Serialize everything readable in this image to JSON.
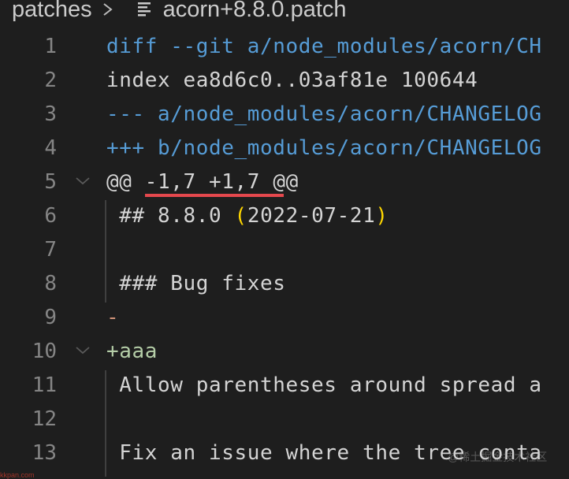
{
  "breadcrumb": {
    "folder": "patches",
    "separator_icon": "chevron-right-icon",
    "file_icon": "text-file-lines-icon",
    "file": "acorn+8.8.0.patch"
  },
  "colors": {
    "background": "#1e1e1e",
    "line_number": "#858585",
    "meta_blue": "#569cd6",
    "text": "#d4d4d4",
    "deletion": "#ce9178",
    "addition": "#b5cea8",
    "bracket": "#ffd700",
    "annotation_underline": "#e5484d"
  },
  "lines": [
    {
      "n": "1",
      "text": "diff --git a/node_modules/acorn/CH",
      "kind": "meta"
    },
    {
      "n": "2",
      "text": "index ea8d6c0..03af81e 100644",
      "kind": "plain"
    },
    {
      "n": "3",
      "text": "--- a/node_modules/acorn/CHANGELOG",
      "kind": "meta"
    },
    {
      "n": "4",
      "text": "+++ b/node_modules/acorn/CHANGELOG",
      "kind": "meta"
    },
    {
      "n": "5",
      "text_parts": [
        "@@ ",
        "-1,7 +1,7 ",
        "@@"
      ],
      "kind": "hunk",
      "foldable": true
    },
    {
      "n": "6",
      "text_parts": [
        " ## 8.8.0 ",
        "(",
        "2022-07-21",
        ")"
      ],
      "kind": "context"
    },
    {
      "n": "7",
      "text": "",
      "kind": "context"
    },
    {
      "n": "8",
      "text": " ### Bug fixes",
      "kind": "context"
    },
    {
      "n": "9",
      "text": "-",
      "kind": "deletion"
    },
    {
      "n": "10",
      "text": "+aaa",
      "kind": "addition",
      "foldable": true
    },
    {
      "n": "11",
      "text": " Allow parentheses around spread a",
      "kind": "context"
    },
    {
      "n": "12",
      "text": "",
      "kind": "context"
    },
    {
      "n": "13",
      "text": " Fix an issue where the tree conta",
      "kind": "context"
    }
  ],
  "annotation": {
    "underlined_text": "-1,7 +1,7"
  },
  "watermarks": {
    "left": "kkpan.com",
    "right": "@稀土掘金技术社区"
  }
}
